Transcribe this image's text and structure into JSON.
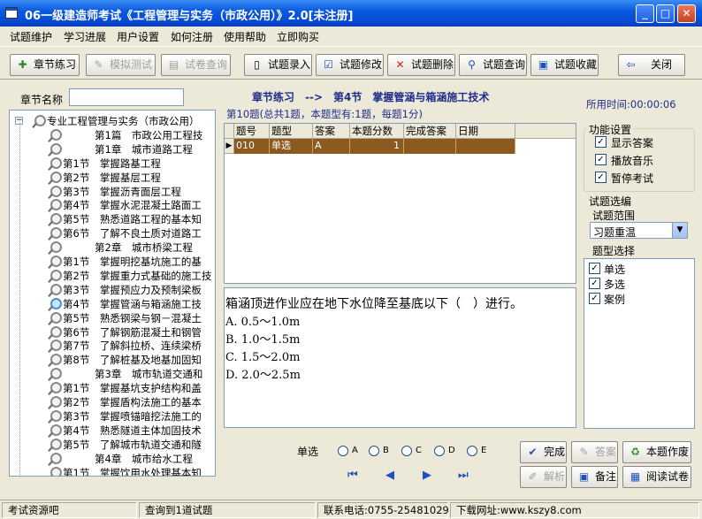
{
  "window": {
    "title": "06一级建造师考试《工程管理与实务（市政公用）》2.0[未注册]",
    "minimize": "_",
    "maximize": "□",
    "close": "✕"
  },
  "menu": [
    "试题维护",
    "学习进展",
    "用户设置",
    "如何注册",
    "使用帮助",
    "立即购买"
  ],
  "toolbar": {
    "chapter_practice": "章节练习",
    "mock_test": "模拟测试",
    "paper_query": "试卷查询",
    "entry": "试题录入",
    "modify": "试题修改",
    "delete": "试题删除",
    "query": "试题查询",
    "favorite": "试题收藏",
    "close": "关闭"
  },
  "left": {
    "chapter_name_label": "章节名称",
    "chapter_name_value": "",
    "tree": [
      {
        "level": 0,
        "label": "专业工程管理与实务（市政公用）",
        "expander": "−"
      },
      {
        "level": 1,
        "label": "第1篇　市政公用工程技"
      },
      {
        "level": 1,
        "label": "第1章　城市道路工程"
      },
      {
        "level": 2,
        "label": "第1节　掌握路基工程"
      },
      {
        "level": 2,
        "label": "第2节　掌握基层工程"
      },
      {
        "level": 2,
        "label": "第3节　掌握沥青面层工程"
      },
      {
        "level": 2,
        "label": "第4节　掌握水泥混凝土路面工"
      },
      {
        "level": 2,
        "label": "第5节　熟悉道路工程的基本知"
      },
      {
        "level": 2,
        "label": "第6节　了解不良土质对道路工"
      },
      {
        "level": 1,
        "label": "第2章　城市桥梁工程"
      },
      {
        "level": 2,
        "label": "第1节　掌握明挖基坑施工的基"
      },
      {
        "level": 2,
        "label": "第2节　掌握重力式基础的施工技"
      },
      {
        "level": 2,
        "label": "第3节　掌握预应力及预制梁板"
      },
      {
        "level": 2,
        "label": "第4节　掌握管涵与箱涵施工技",
        "active": true
      },
      {
        "level": 2,
        "label": "第5节　熟悉钢梁与钢－混凝土"
      },
      {
        "level": 2,
        "label": "第6节　了解钢筋混凝土和钢管"
      },
      {
        "level": 2,
        "label": "第7节　了解斜拉桥、连续梁桥"
      },
      {
        "level": 2,
        "label": "第8节　了解桩基及地基加固知"
      },
      {
        "level": 1,
        "label": "第3章　城市轨道交通和"
      },
      {
        "level": 2,
        "label": "第1节　掌握基坑支护结构和盖"
      },
      {
        "level": 2,
        "label": "第2节　掌握盾构法施工的基本"
      },
      {
        "level": 2,
        "label": "第3节　掌握喷锚暗挖法施工的"
      },
      {
        "level": 2,
        "label": "第4节　熟悉隧道主体加固技术"
      },
      {
        "level": 2,
        "label": "第5节　了解城市轨道交通和隧"
      },
      {
        "level": 1,
        "label": "第4章　城市给水工程"
      },
      {
        "level": 2,
        "label": "第1节　掌握饮用水处理基本知"
      }
    ]
  },
  "header": {
    "breadcrumb": "章节练习　-->　第4节　掌握管涵与箱涵施工技术",
    "summary": "第10题(总共1题，本题型有:1题，每题1分)",
    "elapsed": "所用时间:00:00:06"
  },
  "grid": {
    "columns": [
      "题号",
      "题型",
      "答案",
      "本题分数",
      "完成答案",
      "日期"
    ],
    "rows": [
      [
        "010",
        "单选",
        "A",
        "1",
        "",
        ""
      ]
    ]
  },
  "question": {
    "stem": "箱涵顶进作业应在地下水位降至基底以下（　）进行。",
    "options": [
      "A. 0.5～1.0m",
      "B. 1.0～1.5m",
      "C. 1.5～2.0m",
      "D. 2.0～2.5m"
    ]
  },
  "functions": {
    "legend": "功能设置",
    "items": [
      {
        "label": "显示答案",
        "checked": true
      },
      {
        "label": "播放音乐",
        "checked": true
      },
      {
        "label": "暂停考试",
        "checked": true
      }
    ]
  },
  "selection": {
    "legend": "试题选编",
    "range_label": "试题范围",
    "range_value": "习题重温",
    "type_label": "题型选择",
    "types": [
      {
        "label": "单选",
        "checked": true
      },
      {
        "label": "多选",
        "checked": true
      },
      {
        "label": "案例",
        "checked": true
      }
    ]
  },
  "answer_panel": {
    "type_label": "单选",
    "choices": [
      "A",
      "B",
      "C",
      "D",
      "E"
    ],
    "complete": "完成",
    "answer": "答案",
    "homework": "本题作废",
    "analysis": "解析",
    "note": "备注",
    "review": "阅读试卷",
    "nav": [
      "⏮",
      "◀",
      "▶",
      "⏭"
    ]
  },
  "status": {
    "resource": "考试资源吧",
    "found": "查询到1道试题",
    "phone": "联系电话:0755-25481029",
    "download": "下载网址:www.kszy8.com"
  },
  "colors": {
    "selected_row": "#8c5a1e",
    "title_blue": "#0a5be0",
    "header_text": "#1f2d8c"
  }
}
